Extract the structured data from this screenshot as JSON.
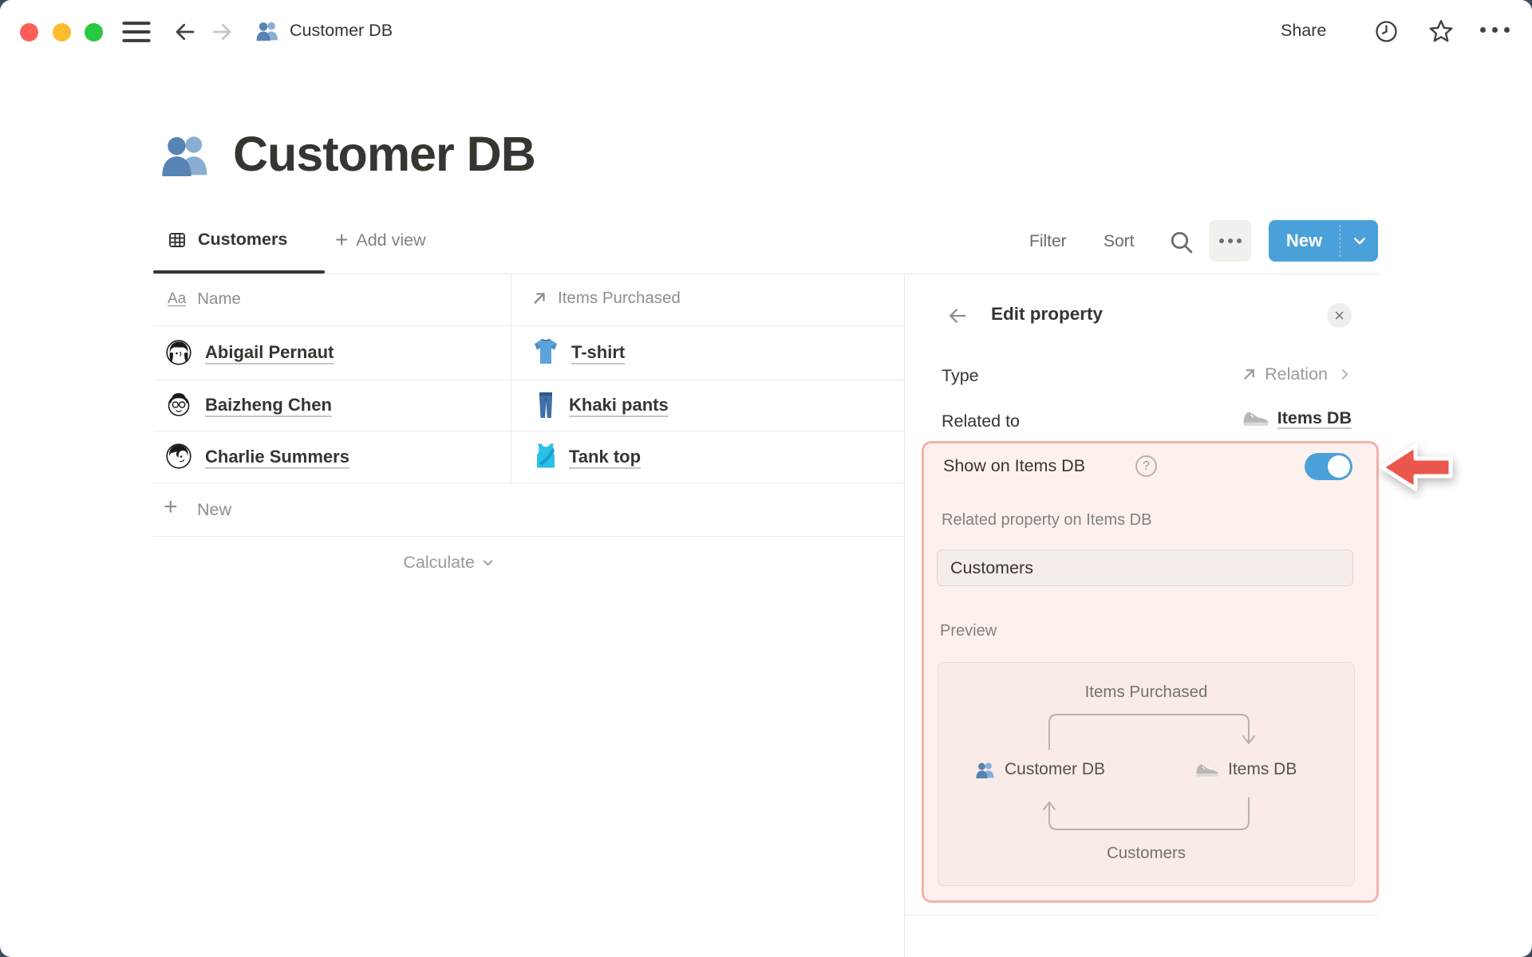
{
  "topbar": {
    "breadcrumb": "Customer DB",
    "share": "Share"
  },
  "page": {
    "title": "Customer DB",
    "icon": "people-icon"
  },
  "view_bar": {
    "tab": "Customers",
    "tab_icon": "table-view-icon",
    "add_view": "Add view",
    "filter": "Filter",
    "sort": "Sort",
    "new_button": "New"
  },
  "table": {
    "columns": [
      {
        "label": "Name",
        "icon": "text-type-icon"
      },
      {
        "label": "Items Purchased",
        "icon": "relation-arrow-icon"
      }
    ],
    "rows": [
      {
        "name": "Abigail Pernaut",
        "avatar_icon": "avatar-abigail",
        "item": "T-shirt",
        "item_icon": "tshirt-icon"
      },
      {
        "name": "Baizheng Chen",
        "avatar_icon": "avatar-baizheng",
        "item": "Khaki pants",
        "item_icon": "khaki-pants-icon"
      },
      {
        "name": "Charlie Summers",
        "avatar_icon": "avatar-charlie",
        "item": "Tank top",
        "item_icon": "tank-top-icon"
      }
    ],
    "new_row": "New",
    "calculate": "Calculate"
  },
  "panel": {
    "title": "Edit property",
    "type_row": {
      "label": "Type",
      "value": "Relation",
      "icon": "relation-arrow-icon"
    },
    "related_row": {
      "label": "Related to",
      "value": "Items DB",
      "icon": "sneaker-icon"
    },
    "highlight": {
      "show_label": "Show on Items DB",
      "toggle_on": true,
      "related_property_label": "Related property on Items DB",
      "input_value": "Customers",
      "preview_label": "Preview",
      "preview": {
        "top_label": "Items Purchased",
        "left_label": "Customer DB",
        "left_icon": "people-icon",
        "right_label": "Items DB",
        "right_icon": "sneaker-icon",
        "bottom_label": "Customers"
      }
    }
  },
  "glyphs": {
    "close": "×",
    "plus": "+",
    "question": "?",
    "aa": "Aa"
  },
  "colors": {
    "accent_blue": "#4aa0d8",
    "highlight_border": "#f2b3ab",
    "highlight_bg": "#fdf1ee",
    "arrow_red": "#e9574d",
    "text_dark": "#37352f",
    "text_gray": "#82817d"
  }
}
